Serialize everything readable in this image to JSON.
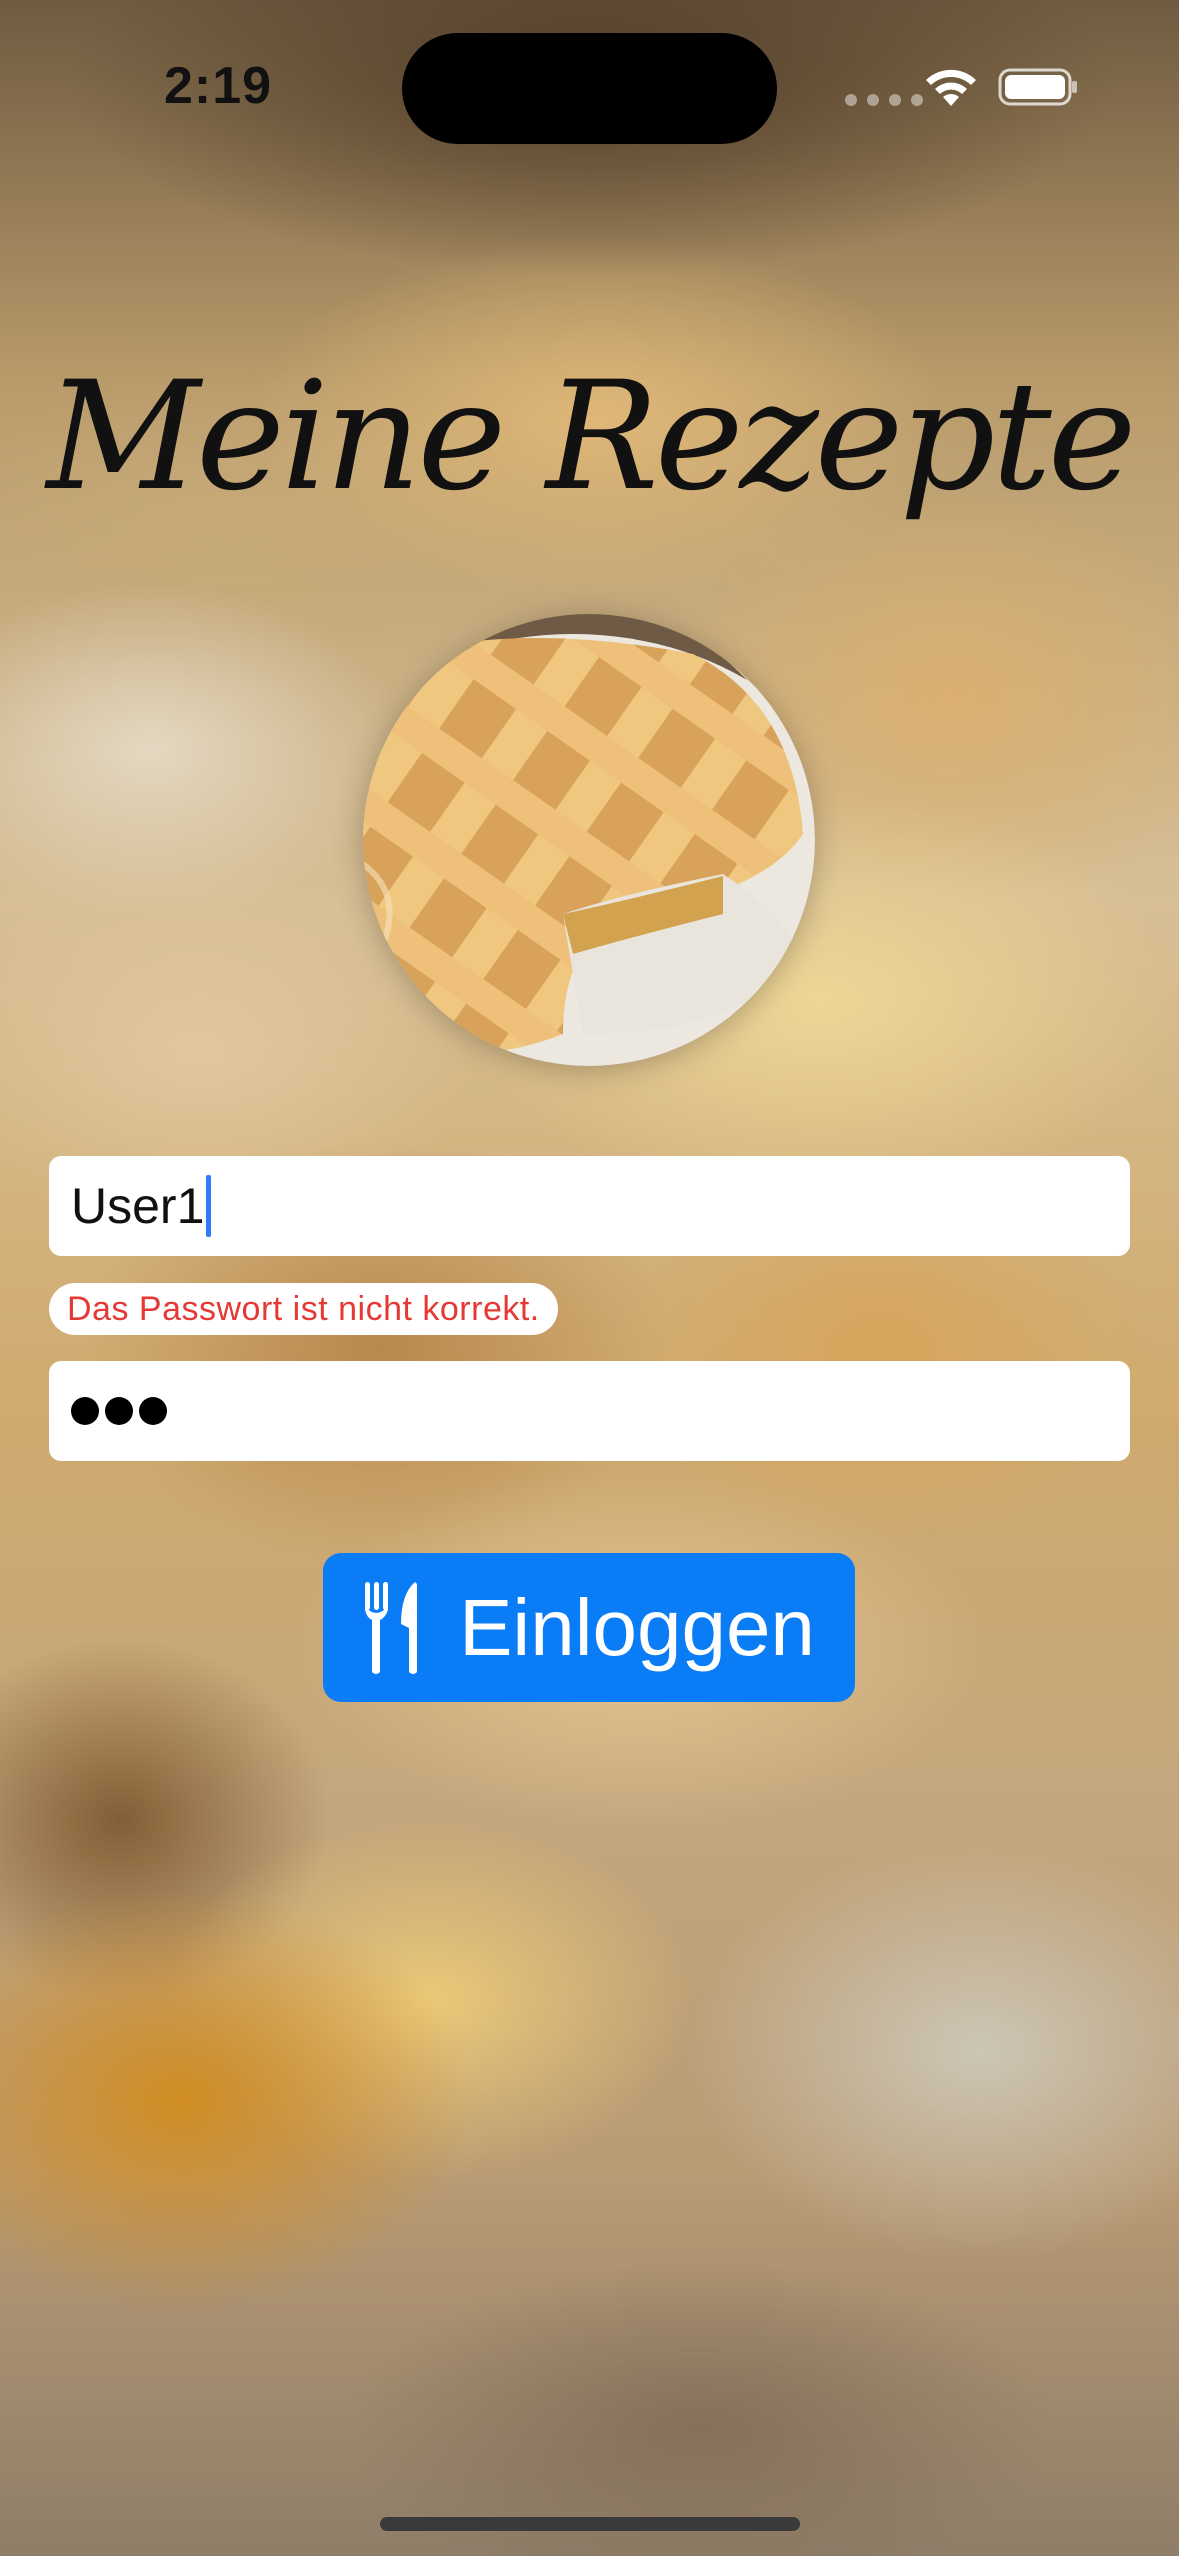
{
  "status_bar": {
    "time": "2:19"
  },
  "app": {
    "title": "Meine Rezepte"
  },
  "login_form": {
    "username_value": "User1",
    "error_message": "Das Passwort ist nicht korrekt.",
    "password_mask_count": 3,
    "login_button_label": "Einloggen",
    "login_button_icon": "fork-knife-icon"
  },
  "colors": {
    "accent": "#0a7cf6",
    "error": "#e53935"
  }
}
